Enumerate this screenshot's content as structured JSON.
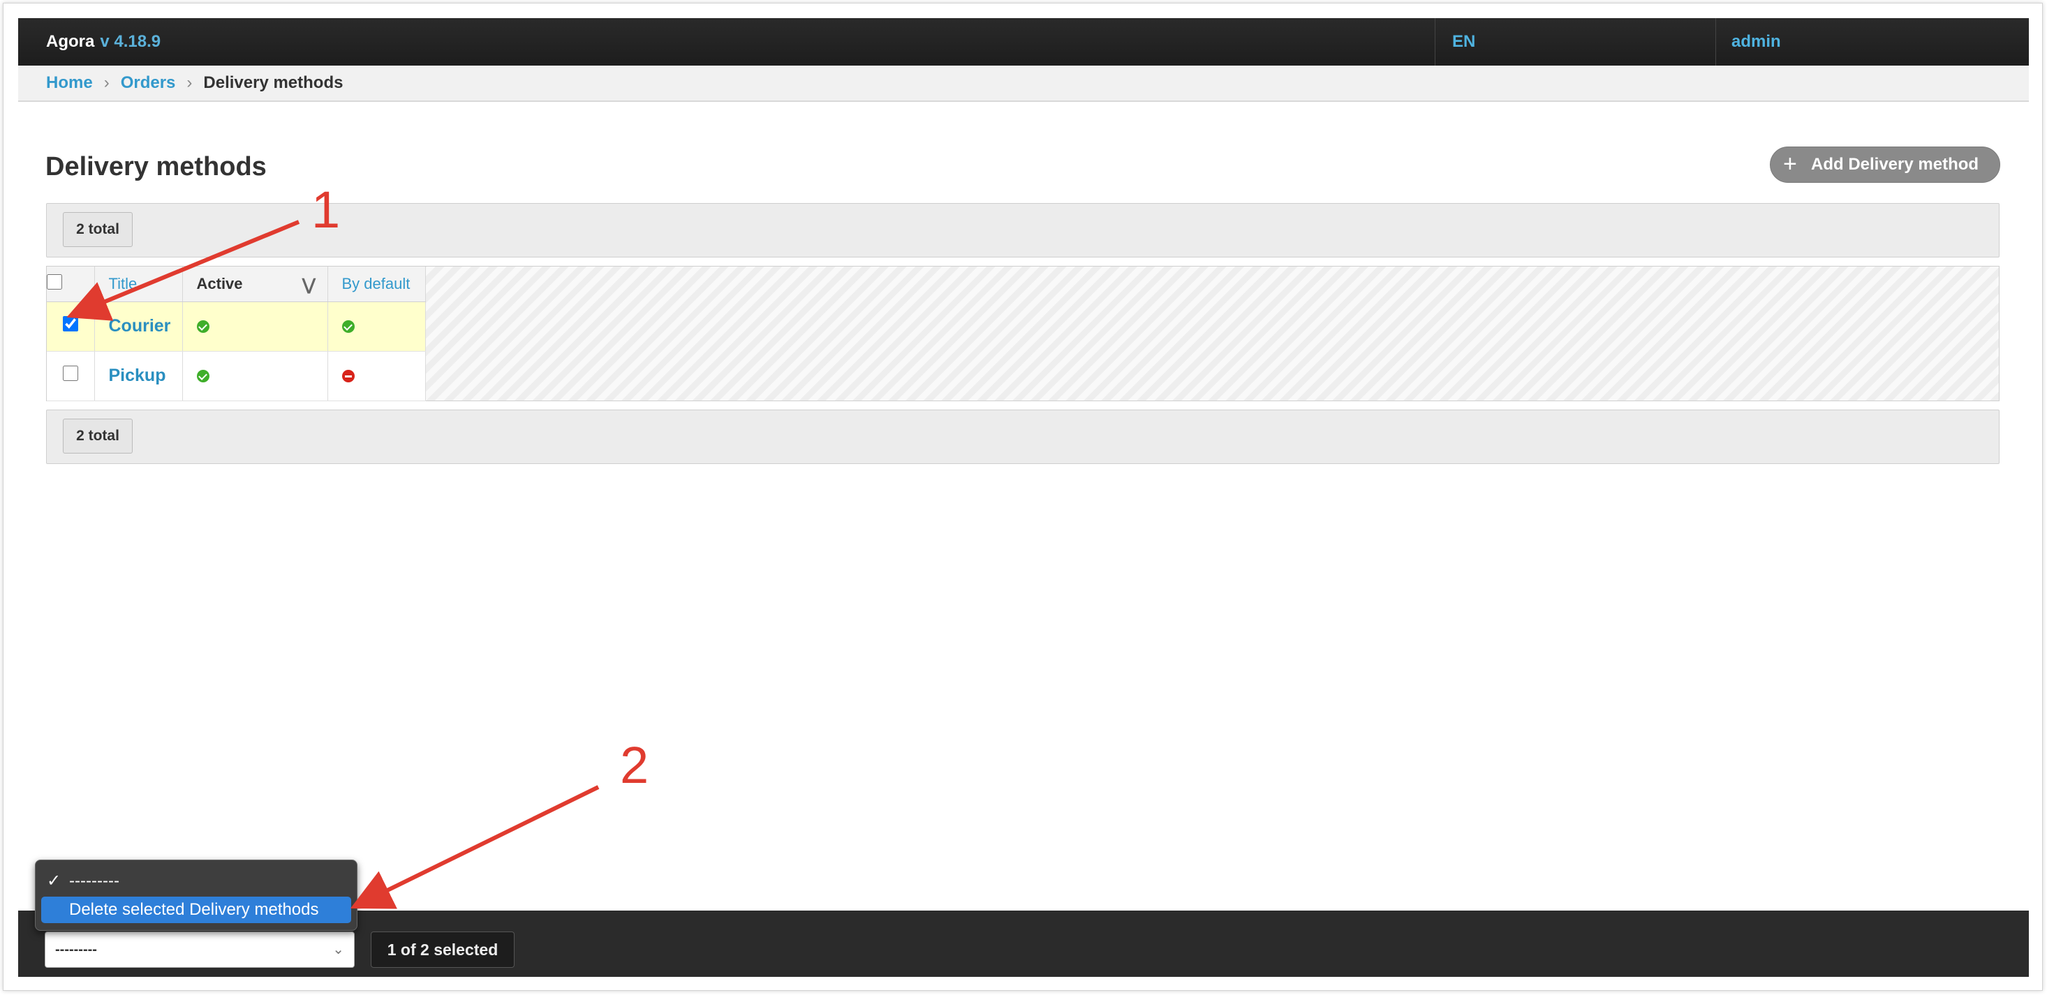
{
  "app": {
    "name": "Agora",
    "version": "v 4.18.9"
  },
  "header": {
    "language": "EN",
    "user": "admin"
  },
  "breadcrumbs": {
    "home": "Home",
    "orders": "Orders",
    "current": "Delivery methods"
  },
  "page": {
    "title": "Delivery methods",
    "add_button": "Add Delivery method"
  },
  "summary": {
    "total_top": "2 total",
    "total_bottom": "2 total"
  },
  "table": {
    "columns": {
      "title": "Title",
      "active": "Active",
      "by_default": "By default"
    },
    "rows": [
      {
        "title": "Courier",
        "active": true,
        "by_default": true,
        "selected": true
      },
      {
        "title": "Pickup",
        "active": true,
        "by_default": false,
        "selected": false
      }
    ]
  },
  "actions": {
    "select_value": "---------",
    "options": [
      "---------",
      "Delete selected Delivery methods"
    ],
    "checked_option": "---------",
    "highlighted_option": "Delete selected Delivery methods",
    "selection_status": "1 of 2 selected"
  },
  "annotations": {
    "marker1": "1",
    "marker2": "2",
    "color": "#e03b2f"
  },
  "colors": {
    "link": "#3399cc",
    "topbar": "#222222",
    "selected_row": "#ffffcc",
    "highlight": "#2e7fd9"
  }
}
